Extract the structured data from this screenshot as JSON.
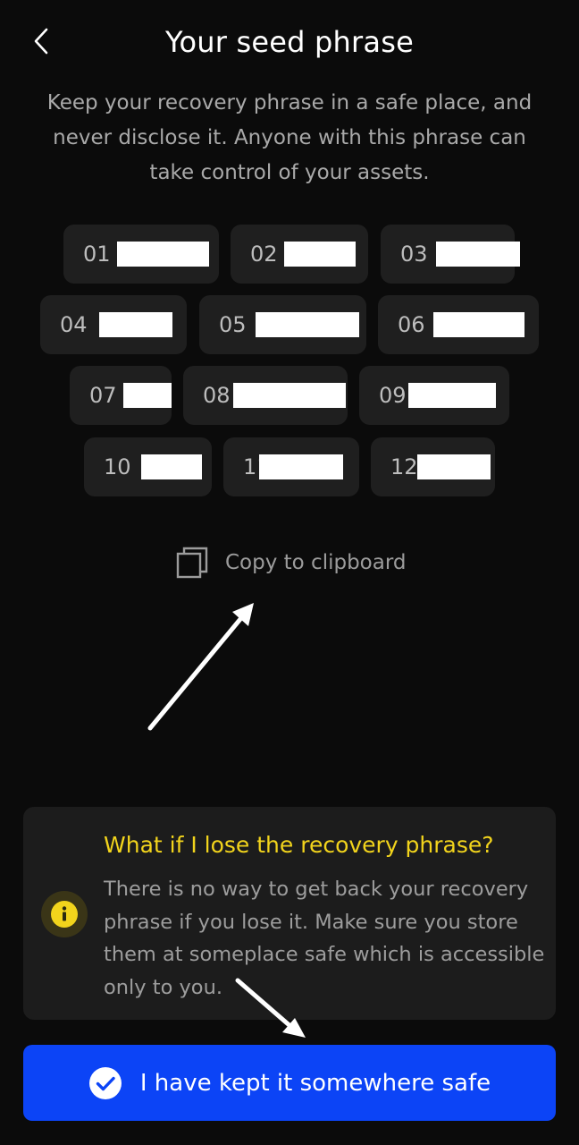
{
  "header": {
    "title": "Your seed phrase"
  },
  "subtitle": "Keep your recovery phrase in a safe place, and never disclose it. Anyone with this phrase can take control of your assets.",
  "seed_words": [
    {
      "index": "01"
    },
    {
      "index": "02"
    },
    {
      "index": "03"
    },
    {
      "index": "04"
    },
    {
      "index": "05"
    },
    {
      "index": "06"
    },
    {
      "index": "07"
    },
    {
      "index": "08"
    },
    {
      "index": "09"
    },
    {
      "index": "10"
    },
    {
      "index": "11"
    },
    {
      "index": "12"
    }
  ],
  "copy": {
    "label": "Copy to clipboard",
    "icon": "copy-icon"
  },
  "info": {
    "title": "What if I lose the recovery phrase?",
    "body": "There is no way to get back your recovery phrase if you lose it. Make sure you store them at someplace safe which is accessible only to you.",
    "icon": "info-icon",
    "title_color": "#F2D41C"
  },
  "confirm_button": {
    "label": "I have kept it somewhere safe",
    "icon": "check-circle-icon",
    "color": "#0C44F6"
  }
}
